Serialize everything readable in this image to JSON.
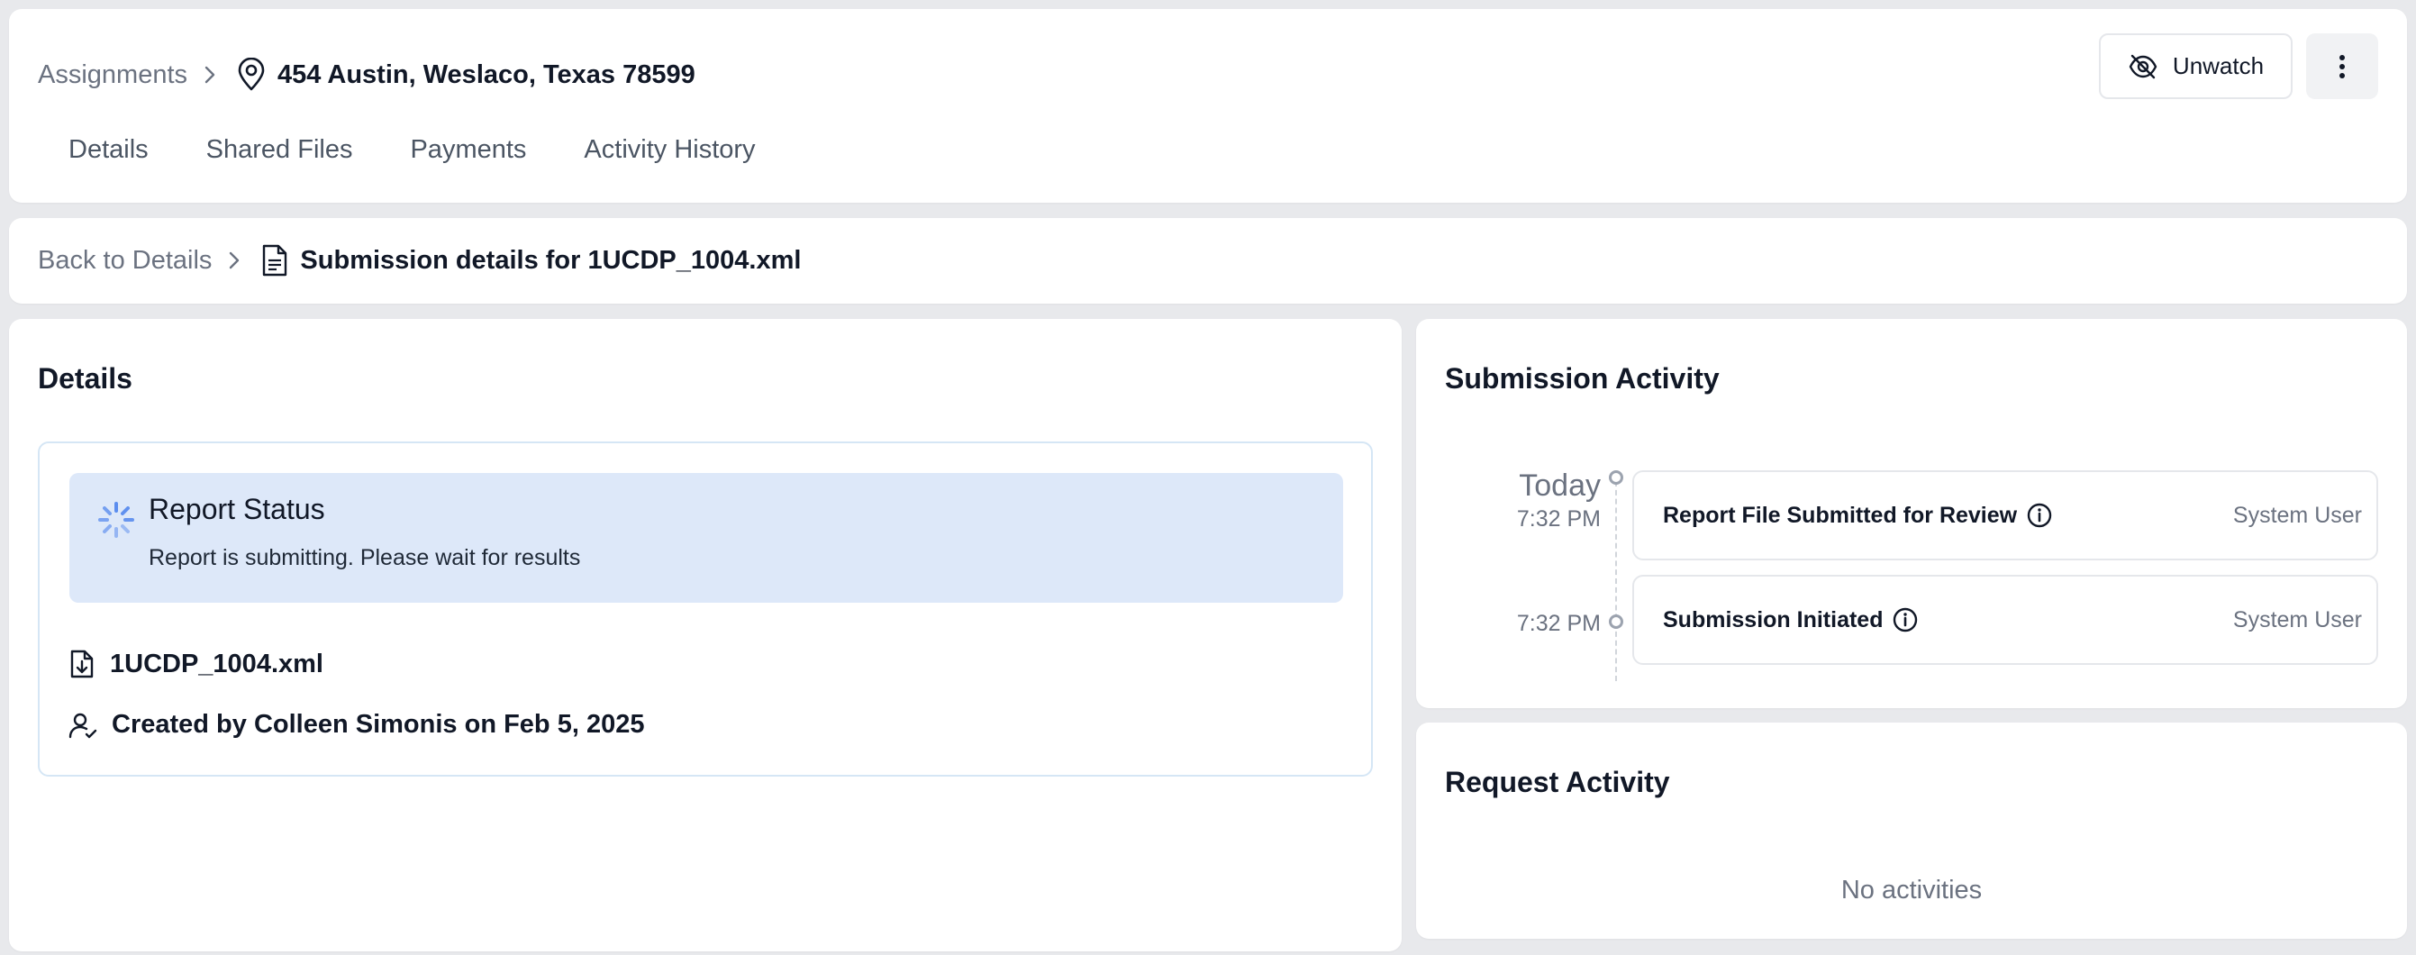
{
  "header": {
    "breadcrumb_root": "Assignments",
    "place_title": "454 Austin, Weslaco, Texas 78599",
    "unwatch_label": "Unwatch",
    "tabs": [
      {
        "label": "Details"
      },
      {
        "label": "Shared Files"
      },
      {
        "label": "Payments"
      },
      {
        "label": "Activity History"
      }
    ]
  },
  "subnav": {
    "back_label": "Back to Details",
    "title": "Submission details for 1UCDP_1004.xml"
  },
  "details": {
    "title": "Details",
    "status": {
      "title": "Report Status",
      "message": "Report is submitting. Please wait for results"
    },
    "file_name": "1UCDP_1004.xml",
    "created_by": "Created by Colleen Simonis on Feb 5, 2025"
  },
  "submission_activity": {
    "title": "Submission Activity",
    "day_label": "Today",
    "items": [
      {
        "time": "7:32 PM",
        "title": "Report File Submitted for Review",
        "user": "System User"
      },
      {
        "time": "7:32 PM",
        "title": "Submission Initiated",
        "user": "System User"
      }
    ]
  },
  "request_activity": {
    "title": "Request Activity",
    "empty_text": "No activities"
  },
  "icons": {
    "location": "map-pin-icon",
    "eye_off": "eye-off-icon",
    "more": "more-vertical-icon",
    "chevron": "chevron-right-icon",
    "document": "document-icon",
    "spinner": "loading-spinner-icon",
    "file_download": "file-download-icon",
    "user_check": "user-check-icon",
    "info": "info-icon"
  },
  "colors": {
    "status_bg": "#dde8f9",
    "spinner": "#5b8def",
    "border_blue": "#d5e6f5",
    "muted_text": "#6b7280"
  }
}
